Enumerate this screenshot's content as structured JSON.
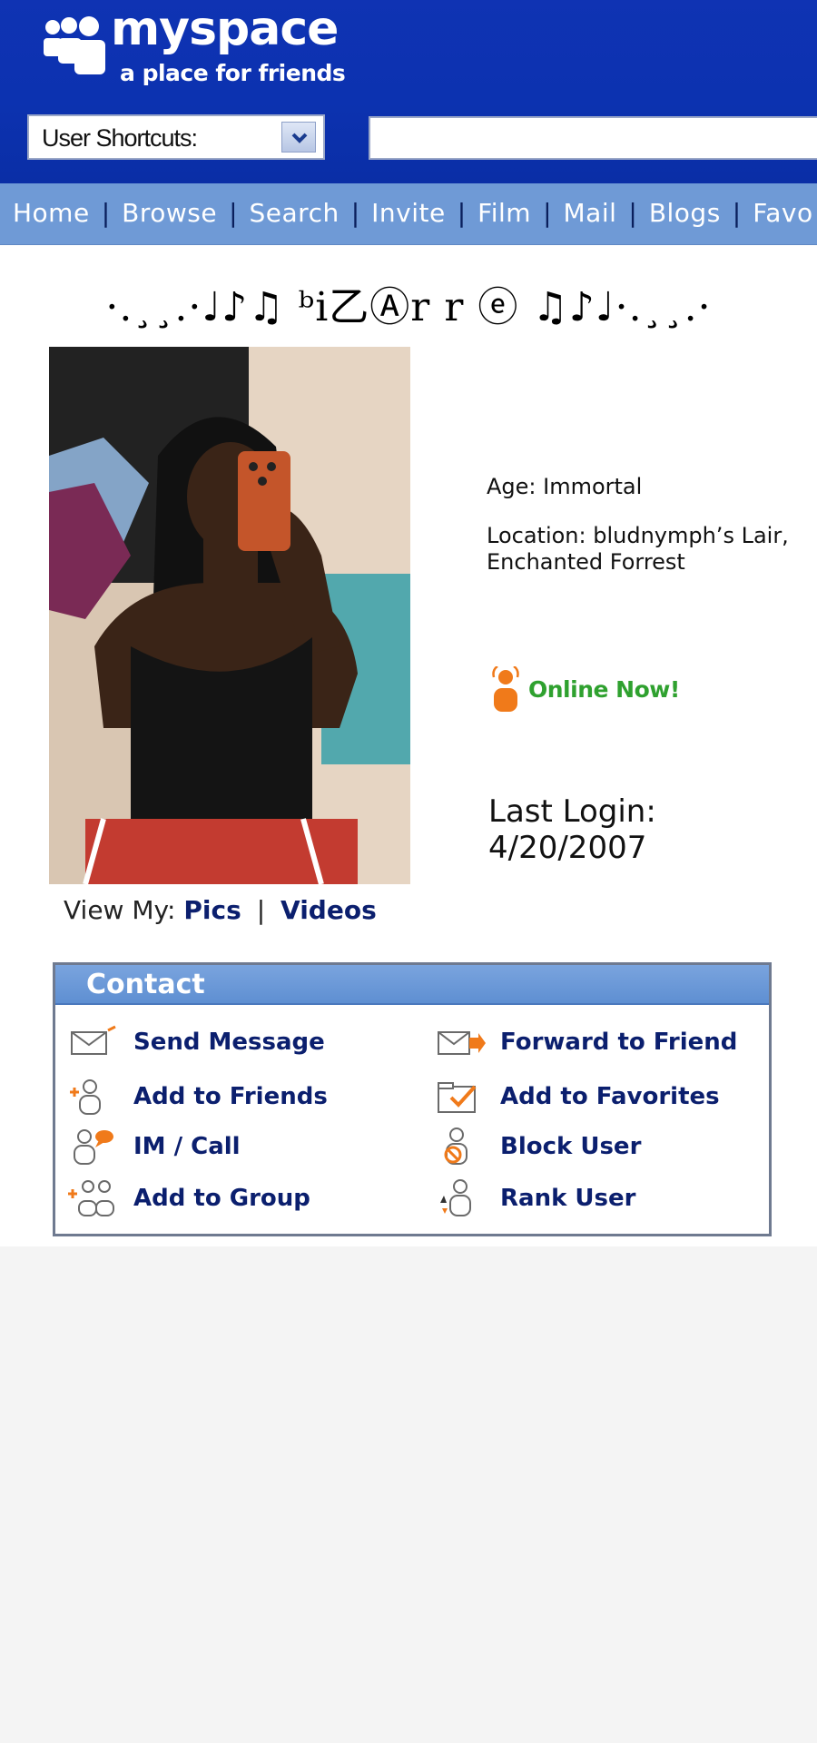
{
  "brand": {
    "name": "myspace",
    "tagline": "a place for friends"
  },
  "header": {
    "shortcuts_label": "User Shortcuts:",
    "search_value": ""
  },
  "nav": {
    "items": [
      "Home",
      "Browse",
      "Search",
      "Invite",
      "Film",
      "Mail",
      "Blogs",
      "Favo"
    ]
  },
  "profile": {
    "display_name": "·.¸¸.·♩♪♫ ᵇi乙Ⓐr r ⓔ ♫♪♩·.¸¸.·",
    "age": "Age: Immortal",
    "location": "Location: bludnymph’s Lair, Enchanted Forrest",
    "online_status": "Online Now!",
    "last_login_label": "Last Login:",
    "last_login_date": "4/20/2007",
    "view_my_label": "View My:",
    "view_links": [
      "Pics",
      "Videos"
    ]
  },
  "contact": {
    "title": "Contact",
    "actions": [
      {
        "label": "Send Message",
        "icon": "envelope-icon"
      },
      {
        "label": "Forward to Friend",
        "icon": "forward-envelope-icon"
      },
      {
        "label": "Add to Friends",
        "icon": "add-friend-icon"
      },
      {
        "label": "Add to Favorites",
        "icon": "favorites-folder-icon"
      },
      {
        "label": "IM / Call",
        "icon": "im-call-icon"
      },
      {
        "label": "Block User",
        "icon": "block-user-icon"
      },
      {
        "label": "Add to Group",
        "icon": "add-group-icon"
      },
      {
        "label": "Rank User",
        "icon": "rank-user-icon"
      }
    ]
  },
  "colors": {
    "header_blue": "#0c32b0",
    "nav_blue": "#6f9ad6",
    "link_navy": "#0b1f6e",
    "online_green": "#2fa12f",
    "icon_orange": "#f07a1a"
  }
}
